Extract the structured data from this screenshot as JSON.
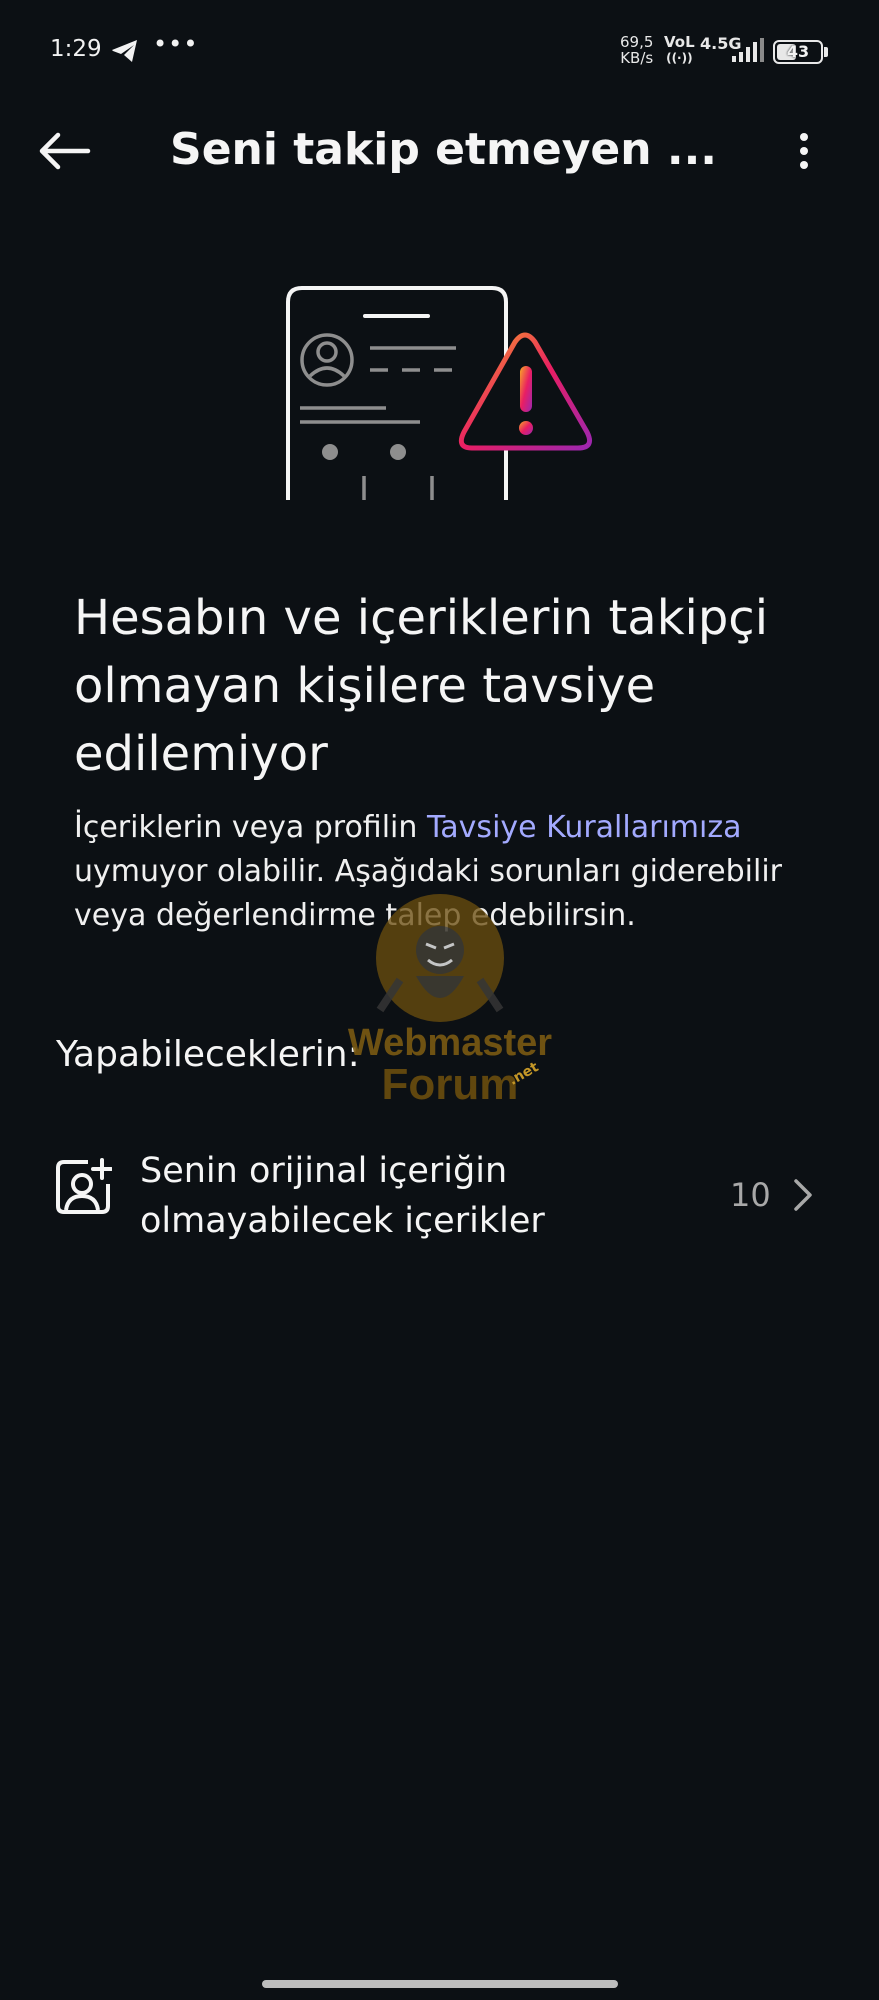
{
  "status_bar": {
    "time": "1:29",
    "speed_value": "69,5",
    "speed_unit": "KB/s",
    "volte": "VoL",
    "network": "4.5G",
    "battery_level": "43",
    "icons": [
      "telegram-icon",
      "more-notifications-icon",
      "hotspot-icon",
      "signal-icon",
      "battery-icon"
    ]
  },
  "header": {
    "title": "Seni takip etmeyen ...",
    "back_icon": "arrow-left-icon",
    "more_icon": "more-vertical-icon"
  },
  "main": {
    "illustration_icon": "phone-warning-illustration",
    "headline": "Hesabın ve içeriklerin takipçi olmayan kişilere tavsiye edilemiyor",
    "desc_before": "İçeriklerin veya profilin ",
    "desc_link": "Tavsiye Kurallarımıza",
    "desc_after": " uymuyor olabilir. Aşağıdaki sorunları giderebilir veya değerlendirme talep edebilirsin.",
    "section_label": "Yapabileceklerin:",
    "items": [
      {
        "icon": "add-person-image-icon",
        "label": "Senin orijinal içeriğin olmayabilecek içerikler",
        "count": "10"
      }
    ]
  },
  "watermark": {
    "line1": "Webmaster",
    "line2": "Forum",
    "tag": ".net"
  },
  "colors": {
    "background": "#0c1014",
    "link": "#a3aaff",
    "warning_gradient": [
      "#f9a825",
      "#e91e63",
      "#9c27b0"
    ]
  }
}
